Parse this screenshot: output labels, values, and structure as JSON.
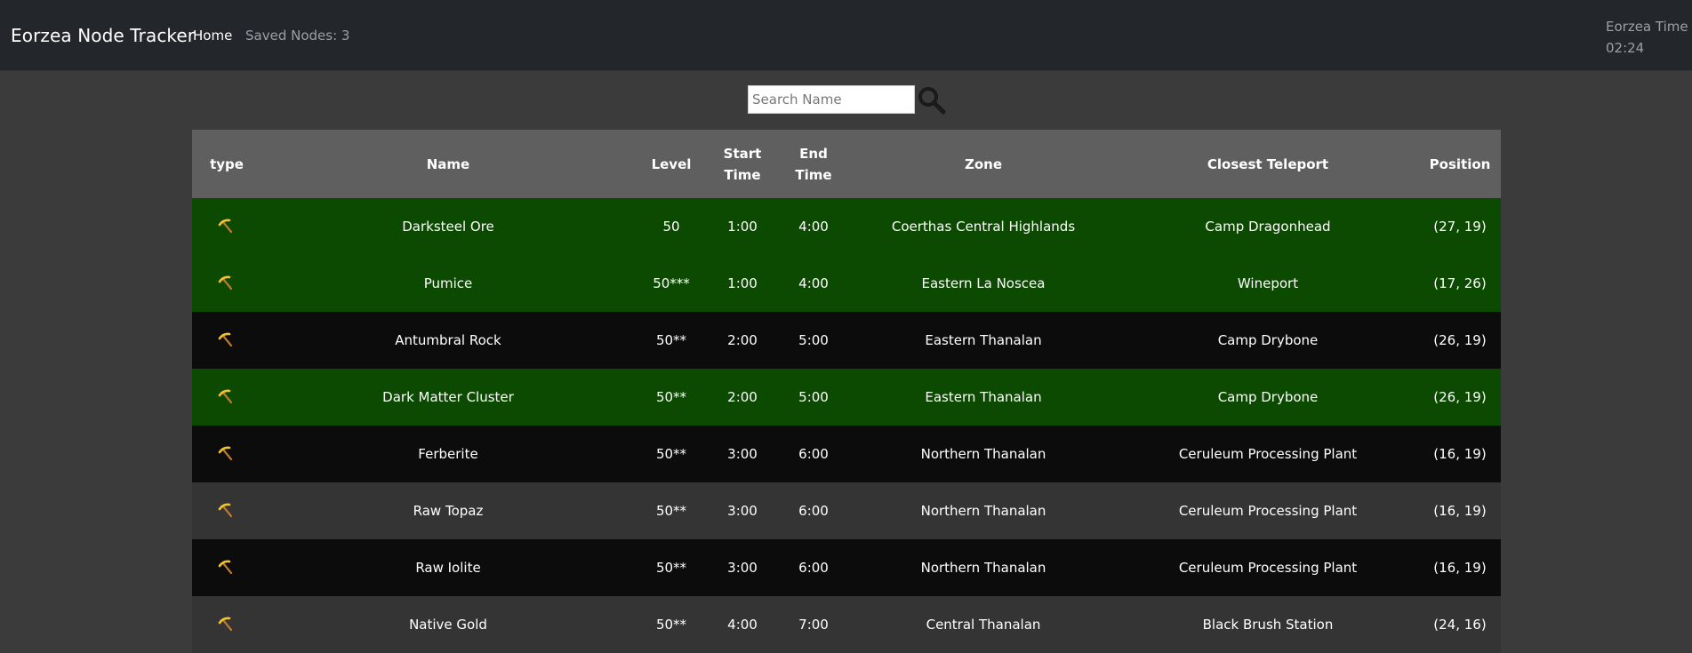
{
  "navbar": {
    "brand": "Eorzea Node Tracker",
    "home_label": "Home",
    "saved_nodes": "Saved Nodes: 3",
    "eorzea_time_label": "Eorzea Time",
    "eorzea_time_value": "02:24"
  },
  "search": {
    "placeholder": "Search Name",
    "icon": "search-icon"
  },
  "table": {
    "headers": {
      "type": "type",
      "name": "Name",
      "level": "Level",
      "start_time": "Start Time",
      "end_time": "End Time",
      "zone": "Zone",
      "closest_teleport": "Closest Teleport",
      "position": "Position"
    },
    "rows": [
      {
        "type_icon": "pickaxe-icon",
        "name": "Darksteel Ore",
        "level": "50",
        "start": "1:00",
        "end": "4:00",
        "zone": "Coerthas Central Highlands",
        "teleport": "Camp Dragonhead",
        "position": "(27, 19)",
        "status": "saved"
      },
      {
        "type_icon": "pickaxe-icon",
        "name": "Pumice",
        "level": "50***",
        "start": "1:00",
        "end": "4:00",
        "zone": "Eastern La Noscea",
        "teleport": "Wineport",
        "position": "(17, 26)",
        "status": "saved"
      },
      {
        "type_icon": "pickaxe-icon",
        "name": "Antumbral Rock",
        "level": "50**",
        "start": "2:00",
        "end": "5:00",
        "zone": "Eastern Thanalan",
        "teleport": "Camp Drybone",
        "position": "(26, 19)",
        "status": "dark"
      },
      {
        "type_icon": "pickaxe-icon",
        "name": "Dark Matter Cluster",
        "level": "50**",
        "start": "2:00",
        "end": "5:00",
        "zone": "Eastern Thanalan",
        "teleport": "Camp Drybone",
        "position": "(26, 19)",
        "status": "saved"
      },
      {
        "type_icon": "pickaxe-icon",
        "name": "Ferberite",
        "level": "50**",
        "start": "3:00",
        "end": "6:00",
        "zone": "Northern Thanalan",
        "teleport": "Ceruleum Processing Plant",
        "position": "(16, 19)",
        "status": "dark"
      },
      {
        "type_icon": "pickaxe-icon",
        "name": "Raw Topaz",
        "level": "50**",
        "start": "3:00",
        "end": "6:00",
        "zone": "Northern Thanalan",
        "teleport": "Ceruleum Processing Plant",
        "position": "(16, 19)",
        "status": "gray"
      },
      {
        "type_icon": "pickaxe-icon",
        "name": "Raw Iolite",
        "level": "50**",
        "start": "3:00",
        "end": "6:00",
        "zone": "Northern Thanalan",
        "teleport": "Ceruleum Processing Plant",
        "position": "(16, 19)",
        "status": "dark"
      },
      {
        "type_icon": "pickaxe-icon",
        "name": "Native Gold",
        "level": "50**",
        "start": "4:00",
        "end": "7:00",
        "zone": "Central Thanalan",
        "teleport": "Black Brush Station",
        "position": "(24, 16)",
        "status": "gray"
      }
    ]
  },
  "colors": {
    "navbar_bg": "#23272b",
    "page_bg": "#3b3b3b",
    "header_bg": "#5f5f5f",
    "saved_row": "#0c4a02",
    "dark_row": "#0c0c0c",
    "gray_row": "#343434",
    "pickaxe_head": "#f2c230",
    "pickaxe_handle": "#c07a2a"
  }
}
